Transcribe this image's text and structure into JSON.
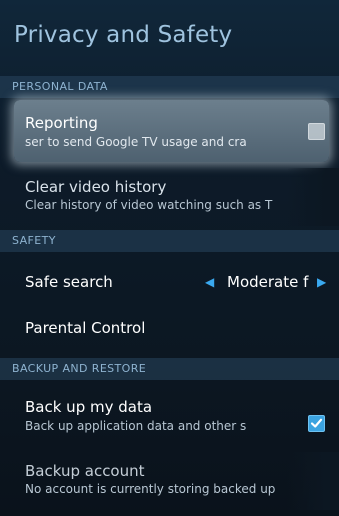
{
  "title": "Privacy and Safety",
  "sections": {
    "personal_data": "PERSONAL DATA",
    "safety": "SAFETY",
    "backup": "BACKUP AND RESTORE"
  },
  "reporting": {
    "label": "Reporting",
    "summary": "ser to send Google TV usage and cra",
    "checked": false
  },
  "clear_history": {
    "label": "Clear video history",
    "summary": "Clear history of video watching such as T"
  },
  "safe_search": {
    "label": "Safe search",
    "value": "Moderate f",
    "icons": {
      "left": "left-arrow-icon",
      "right": "right-arrow-icon"
    }
  },
  "parental": {
    "label": "Parental Control"
  },
  "backup_data": {
    "label": "Back up my data",
    "summary": "Back up application data and other s",
    "checked": true
  },
  "backup_account": {
    "label": "Backup account",
    "summary": "No account is currently storing backed up"
  },
  "colors": {
    "accent": "#3aa9f0",
    "title": "#9fc3df"
  }
}
